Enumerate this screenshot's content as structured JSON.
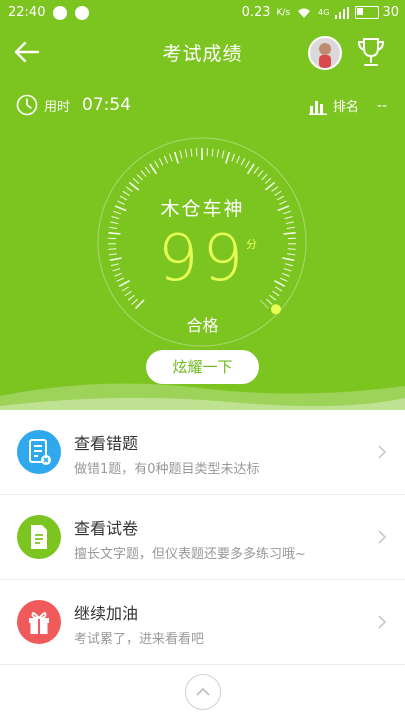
{
  "status_bar": {
    "time": "22:40",
    "net_speed": "0.23",
    "net_unit": "K/s",
    "network": "4G",
    "battery": "30"
  },
  "header": {
    "title": "考试成绩"
  },
  "stats": {
    "time_label": "用时",
    "time_value": "07:54",
    "rank_label": "排名",
    "rank_value": "--"
  },
  "result": {
    "name": "木仓车神",
    "score": "99",
    "unit": "分",
    "status": "合格",
    "score_fraction": 0.99
  },
  "share_button": "炫耀一下",
  "actions": [
    {
      "title": "查看错题",
      "subtitle": "做错1题，有0种题目类型未达标",
      "icon": "wrong-answer-icon",
      "color": "#2fa8ee"
    },
    {
      "title": "查看试卷",
      "subtitle": "擅长文字题，但仪表题还要多多练习哦~",
      "icon": "paper-icon",
      "color": "#7cc520"
    },
    {
      "title": "继续加油",
      "subtitle": "考试累了，进来看看吧",
      "icon": "gift-icon",
      "color": "#f05a5a"
    }
  ],
  "colors": {
    "accent": "#7cc520",
    "score": "#e6ff55"
  }
}
